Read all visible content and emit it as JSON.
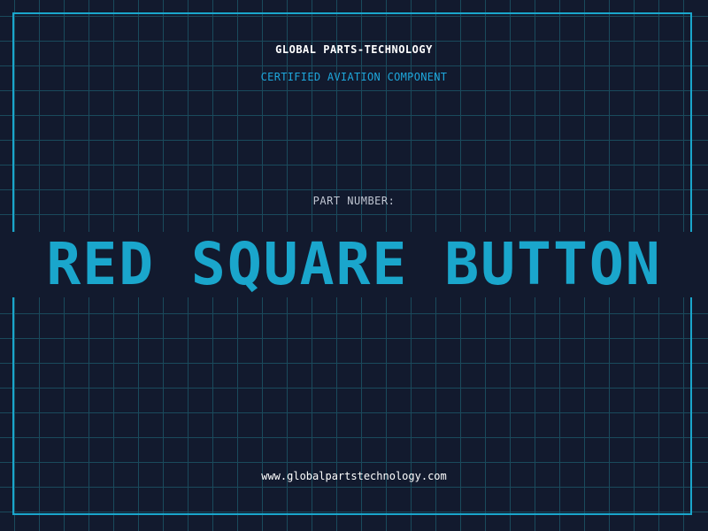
{
  "header": {
    "company": "GLOBAL PARTS-TECHNOLOGY",
    "subtitle": "CERTIFIED AVIATION COMPONENT"
  },
  "part": {
    "label": "PART NUMBER:",
    "name": "RED SQUARE BUTTON"
  },
  "footer": {
    "website": "www.globalpartstechnology.com"
  },
  "colors": {
    "background": "#121a2e",
    "grid": "#1a4a5c",
    "accent": "#1aa6cc",
    "subtitle": "#1ea7dc"
  }
}
